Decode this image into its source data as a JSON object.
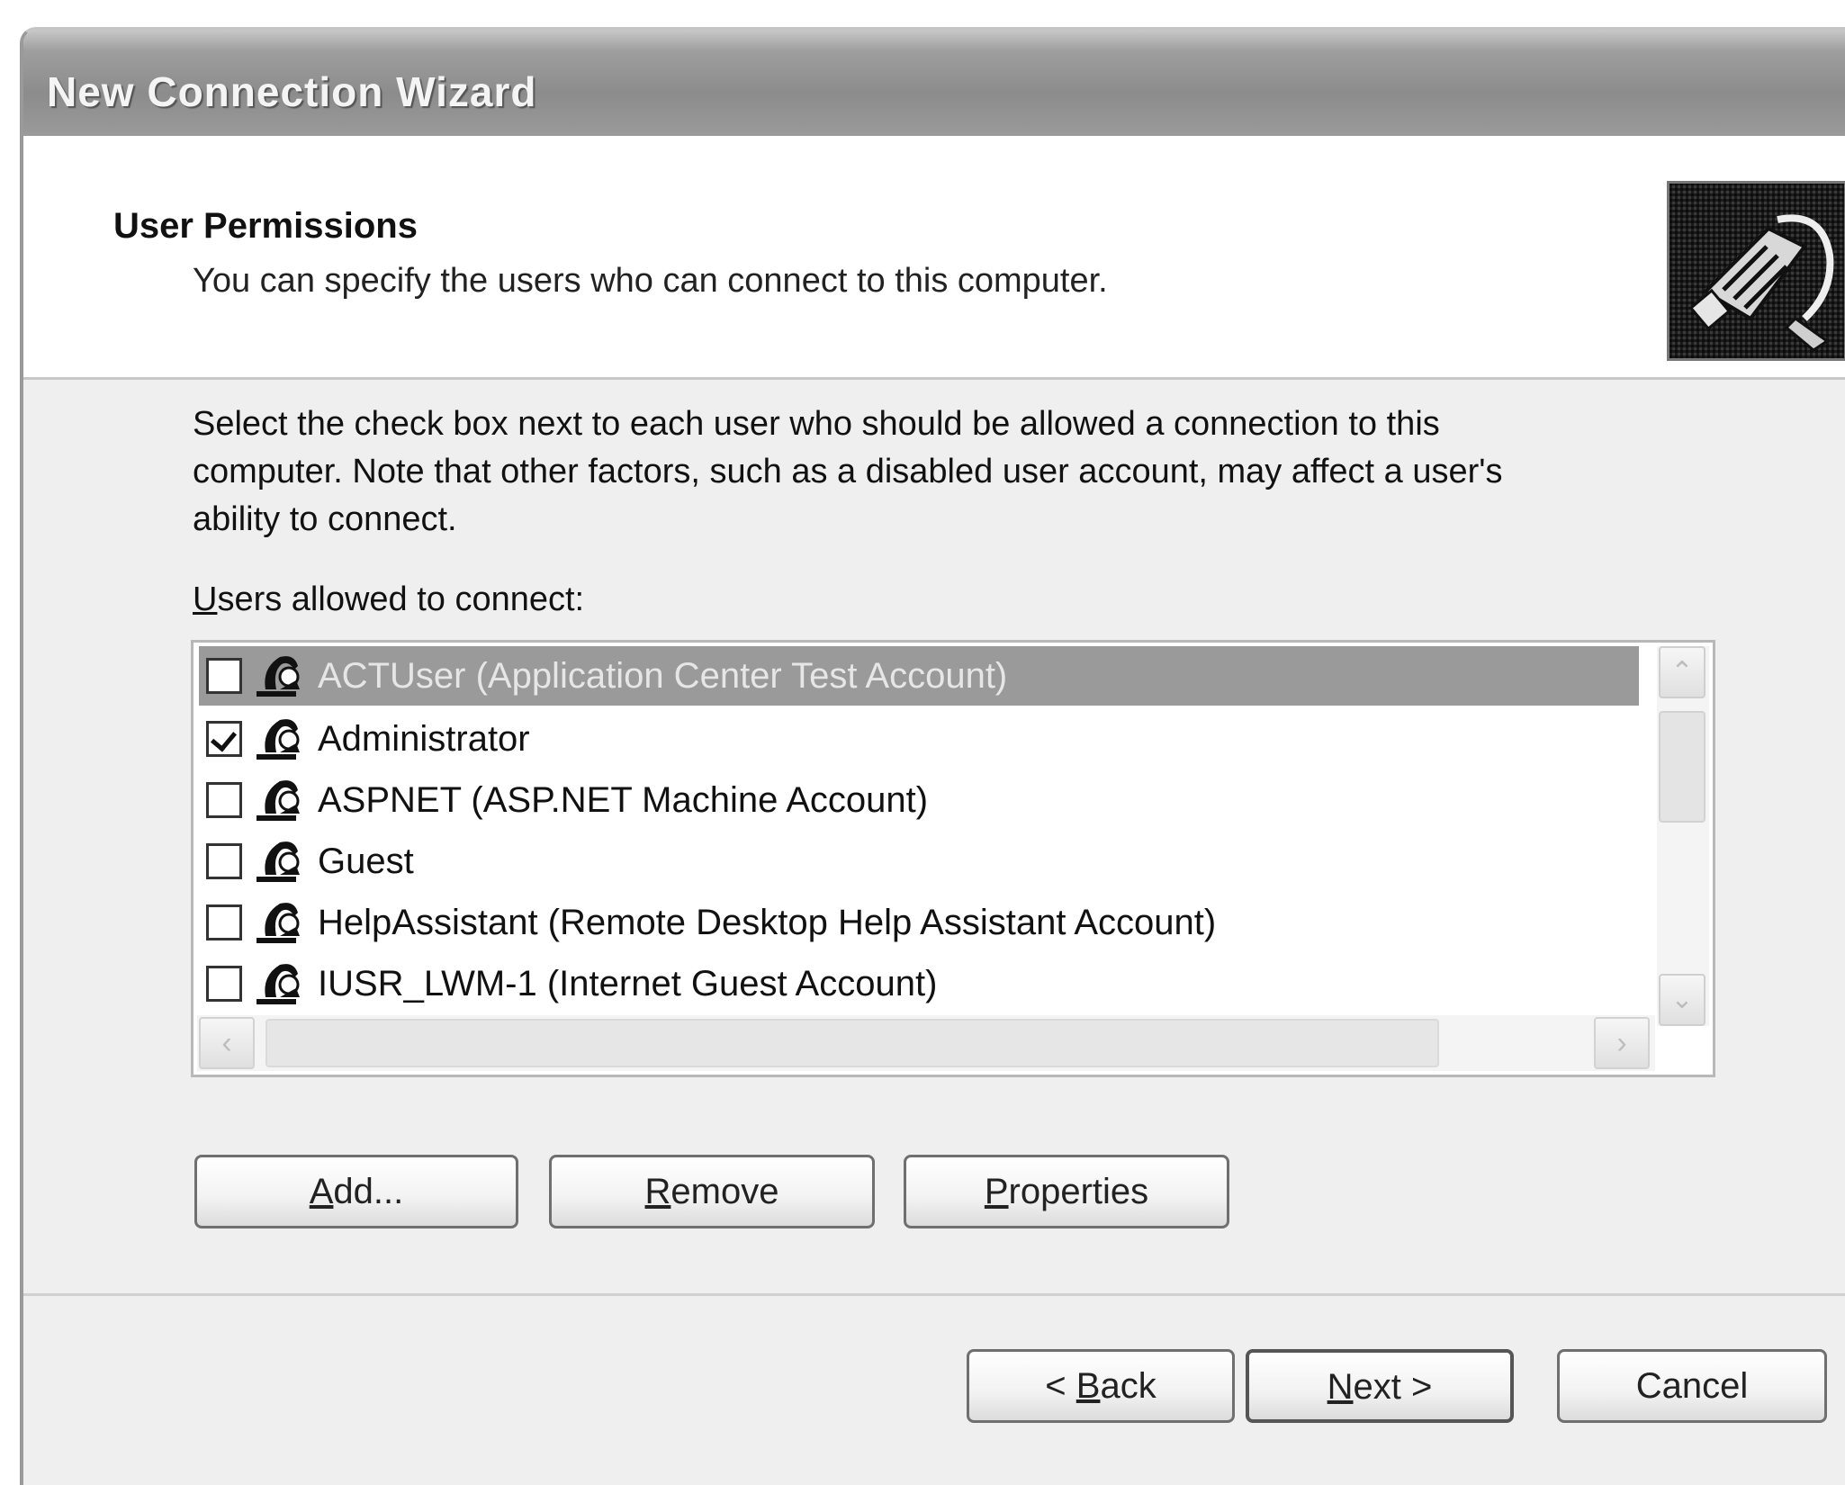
{
  "window": {
    "title": "New Connection Wizard"
  },
  "header": {
    "title": "User Permissions",
    "subtitle": "You can specify the users who can connect to this computer.",
    "icon": "connection-plug-icon"
  },
  "body": {
    "line1": "Select the check box next to each user who should be allowed a connection to this",
    "line2": "computer.  Note that other factors, such as a disabled user account, may affect a user's",
    "line3": "ability to connect."
  },
  "list": {
    "label_key": "U",
    "label_rest": "sers allowed to connect:",
    "users": [
      {
        "name": "ACTUser (Application Center Test Account)",
        "checked": false,
        "selected": true
      },
      {
        "name": "Administrator",
        "checked": true,
        "selected": false
      },
      {
        "name": "ASPNET (ASP.NET Machine Account)",
        "checked": false,
        "selected": false
      },
      {
        "name": "Guest",
        "checked": false,
        "selected": false
      },
      {
        "name": "HelpAssistant (Remote Desktop Help Assistant Account)",
        "checked": false,
        "selected": false
      },
      {
        "name": "IUSR_LWM-1 (Internet Guest Account)",
        "checked": false,
        "selected": false
      }
    ]
  },
  "actions": {
    "add_key": "A",
    "add_rest": "dd...",
    "remove_key": "R",
    "remove_rest": "emove",
    "properties_key": "P",
    "properties_rest": "roperties"
  },
  "footer": {
    "back_pre": "< ",
    "back_key": "B",
    "back_rest": "ack",
    "next_key": "N",
    "next_rest": "ext >",
    "cancel": "Cancel"
  }
}
